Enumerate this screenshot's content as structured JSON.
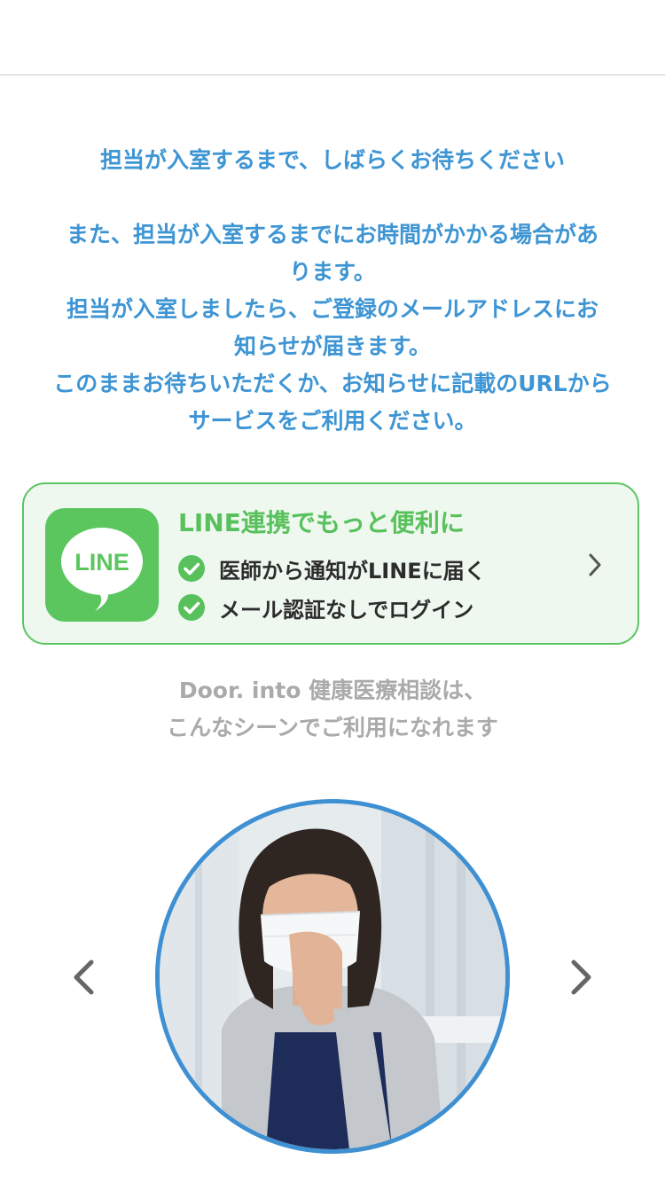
{
  "status_message": {
    "line1": "担当が入室するまで、しばらくお待ちください",
    "line2": "また、担当が入室するまでにお時間がかかる場合があ",
    "line3": "ります。",
    "line4": "担当が入室しましたら、ご登録のメールアドレスにお",
    "line5": "知らせが届きます。",
    "line6": "このままお待ちいただくか、お知らせに記載のURLから",
    "line7": "サービスをご利用ください。"
  },
  "line_banner": {
    "logo_text": "LINE",
    "title": "LINE連携でもっと便利に",
    "benefits": [
      "医師から通知がLINEに届く",
      "メール認証なしでログイン"
    ],
    "icon": "chevron-right-icon",
    "accent_color": "#58c15c",
    "background_color": "#eef8ef"
  },
  "scene_caption": {
    "line1": "Door. into 健康医療相談は、",
    "line2": "こんなシーンでご利用になれます"
  },
  "carousel": {
    "prev_icon": "chevron-left-icon",
    "next_icon": "chevron-right-icon",
    "image": "woman-coughing-with-mask-photo",
    "border_color": "#3e90d2"
  },
  "colors": {
    "message_text": "#3e95d4",
    "caption_text": "#aaaaaa"
  }
}
